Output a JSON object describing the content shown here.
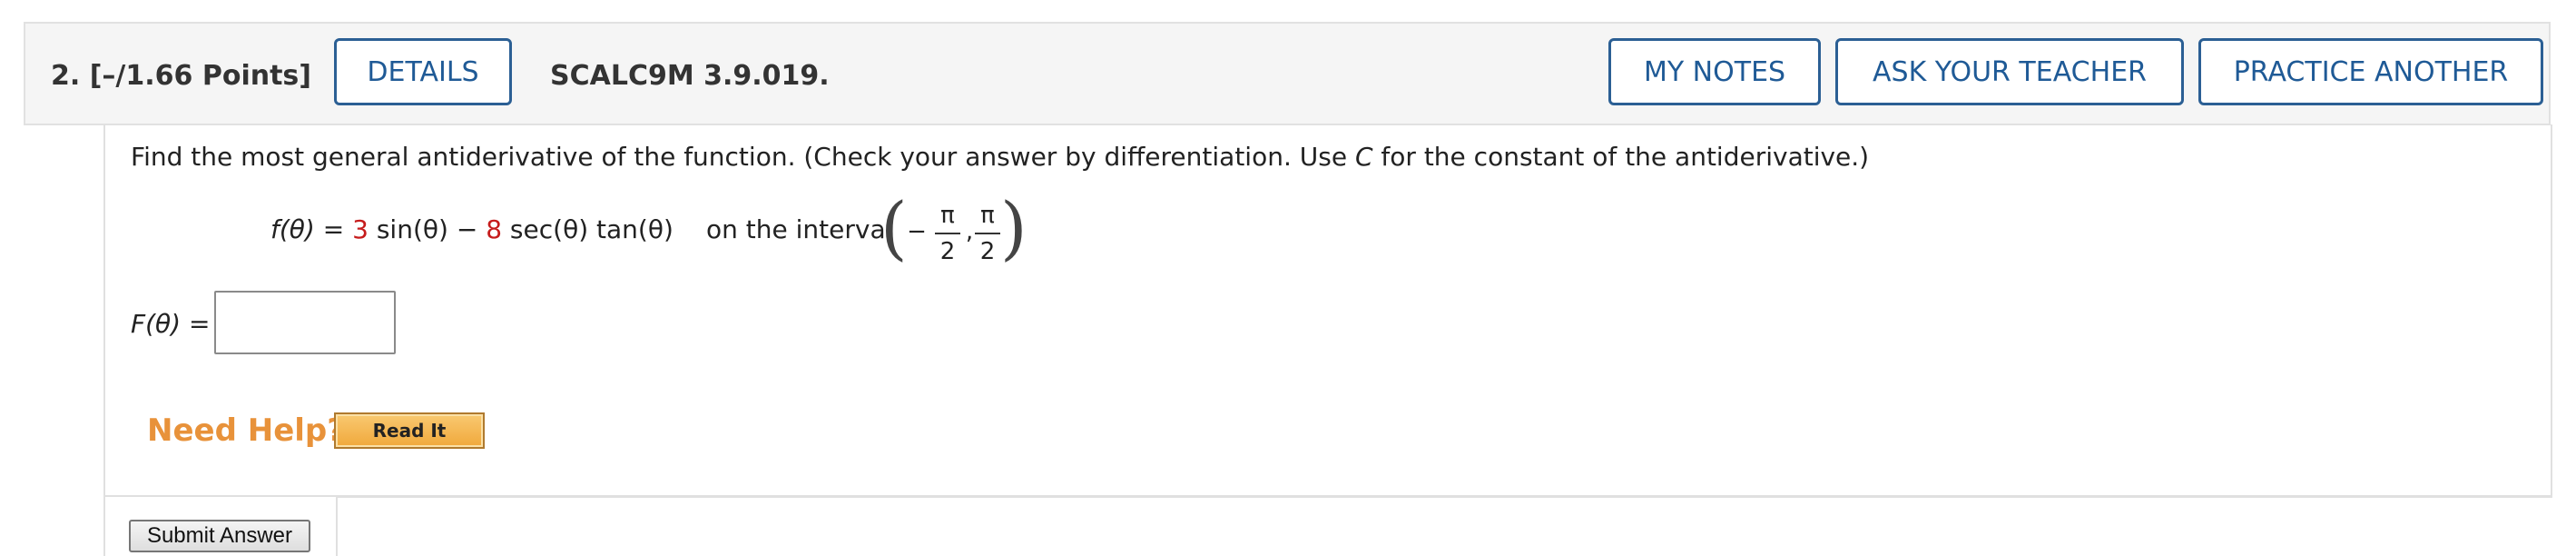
{
  "header": {
    "question_label": "2.  [–/1.66 Points]",
    "details_label": "DETAILS",
    "code": "SCALC9M 3.9.019.",
    "my_notes_label": "MY NOTES",
    "ask_teacher_label": "ASK YOUR TEACHER",
    "practice_label": "PRACTICE ANOTHER"
  },
  "question": {
    "instruction_part1": "Find the most general antiderivative of the function. (Check your answer by differentiation. Use ",
    "instruction_var": "C",
    "instruction_part2": " for the constant of the antiderivative.)",
    "f_lhs": "f(θ) = ",
    "coef1": "3",
    "term1": " sin(θ) − ",
    "coef2": "8",
    "term2": " sec(θ) tan(θ)",
    "interval_label": "on the interval",
    "interval_minus": "−",
    "pi": "π",
    "two": "2",
    "comma": ","
  },
  "answer": {
    "label": "F(θ) =",
    "value": ""
  },
  "help": {
    "need_help": "Need Help?",
    "read_it": "Read It"
  },
  "submit_label": "Submit Answer",
  "colors": {
    "accent": "#2b5f94",
    "coefficient": "#c61c1c",
    "need_help": "#e8923a"
  }
}
